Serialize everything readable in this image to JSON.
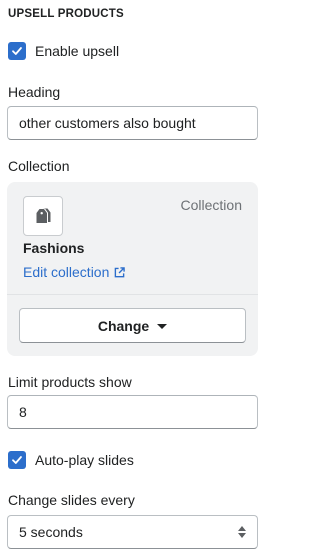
{
  "section": {
    "title": "UPSELL PRODUCTS"
  },
  "enable_upsell": {
    "label": "Enable upsell",
    "checked": true,
    "icon": "checkmark-icon"
  },
  "heading": {
    "label": "Heading",
    "value": "other customers also bought"
  },
  "collection": {
    "label": "Collection",
    "type_label": "Collection",
    "name": "Fashions",
    "edit_link": "Edit collection",
    "edit_icon": "external-link-icon",
    "thumb_icon": "collection-tags-icon",
    "change_button": "Change"
  },
  "limit": {
    "label": "Limit products show",
    "value": "8"
  },
  "autoplay": {
    "label": "Auto-play slides",
    "checked": true,
    "icon": "checkmark-icon"
  },
  "slides_every": {
    "label": "Change slides every",
    "selected": "5 seconds"
  },
  "colors": {
    "accent": "#2c6ecb",
    "card_bg": "#f1f2f3",
    "text": "#202223",
    "muted": "#6d7175"
  }
}
